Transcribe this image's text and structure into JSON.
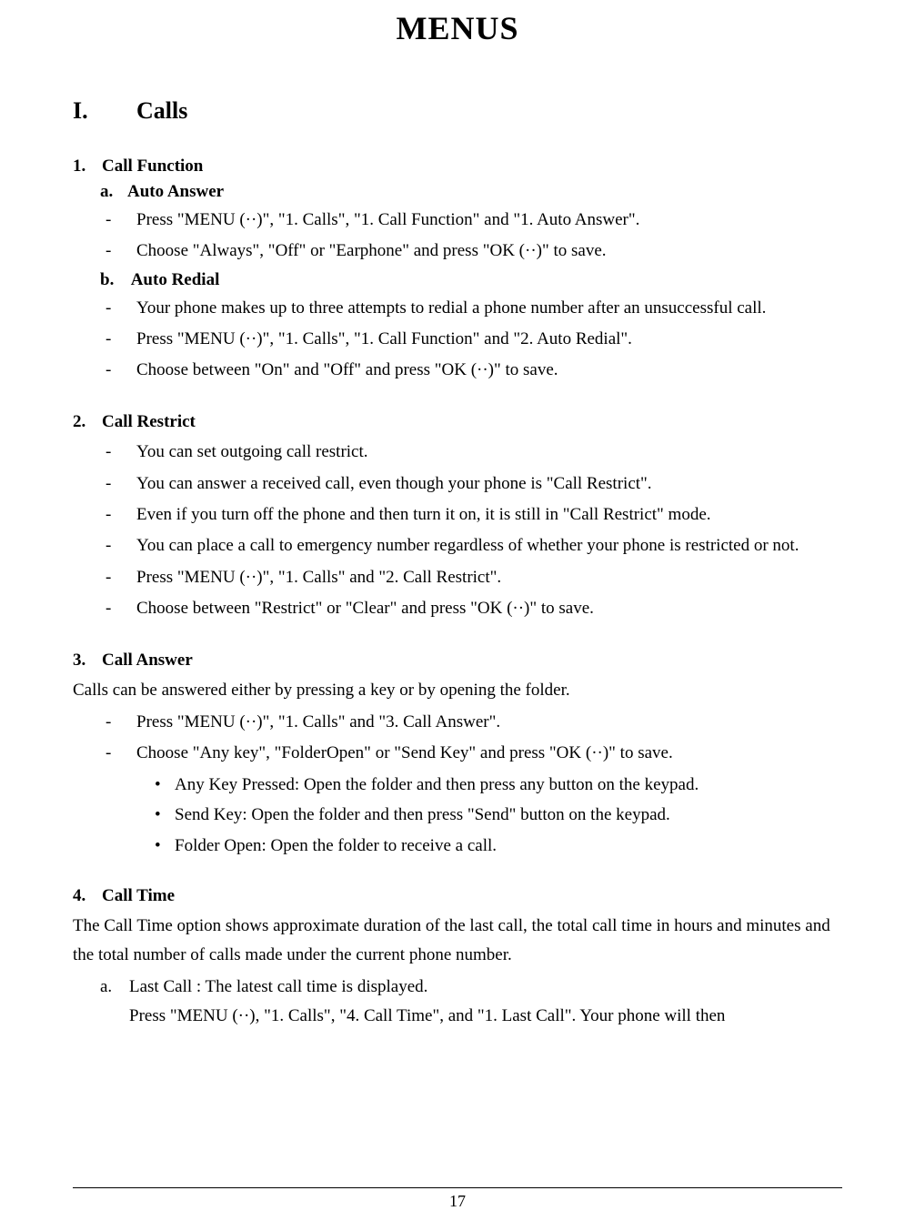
{
  "title": "MENUS",
  "heading": {
    "num": "I.",
    "label": "Calls"
  },
  "sections": {
    "s1": {
      "num": "1.",
      "label": "Call Function",
      "a": {
        "lett": "a.",
        "label": "Auto Answer"
      },
      "a_items": [
        "Press \"MENU (··)\", \"1. Calls\", \"1. Call Function\" and \"1. Auto Answer\".",
        "Choose \"Always\", \"Off\" or \"Earphone\" and press \"OK (··)\" to save."
      ],
      "b": {
        "lett": "b.",
        "label": " Auto Redial"
      },
      "b_items": [
        "Your phone makes up to three attempts to redial a phone number after an unsuccessful call.",
        "Press \"MENU (··)\", \"1. Calls\", \"1. Call Function\" and \"2. Auto Redial\".",
        "Choose between \"On\" and \"Off\" and press \"OK (··)\" to save."
      ]
    },
    "s2": {
      "num": "2.",
      "label": "Call Restrict",
      "items": [
        "You can set outgoing call restrict.",
        "You can answer a received call, even though your phone is \"Call Restrict\".",
        "Even if you turn off the phone and then turn it on, it is still in \"Call Restrict\" mode.",
        "You can place a call to emergency number regardless of whether your phone is restricted or not.",
        "Press \"MENU (··)\", \"1. Calls\" and \"2. Call Restrict\".",
        "Choose between \"Restrict\" or \"Clear\" and press \"OK (··)\" to save."
      ]
    },
    "s3": {
      "num": "3.",
      "label": "Call Answer",
      "intro": "Calls can be answered either by pressing a key or by opening the folder.",
      "items": [
        "Press \"MENU (··)\", \"1. Calls\" and \"3. Call Answer\".",
        "Choose \"Any key\", \"FolderOpen\" or \"Send Key\" and press \"OK (··)\" to save."
      ],
      "bullets": [
        "Any Key Pressed: Open the folder and then press any button on the keypad.",
        "Send Key: Open the folder and then press \"Send\" button on the keypad.",
        "Folder Open: Open the folder to receive a call."
      ]
    },
    "s4": {
      "num": "4.",
      "label": "Call Time",
      "intro": "The Call Time option shows approximate duration of the last call, the total call time in hours and minutes and the total number of calls made under the current phone number.",
      "a_lett": "a.",
      "a_line1": "Last Call : The latest call time is displayed.",
      "a_line2": "Press \"MENU (··), \"1. Calls\", \"4. Call Time\", and \"1. Last Call\". Your phone will then"
    }
  },
  "dash": "-",
  "bullet": "•",
  "pageNumber": "17"
}
